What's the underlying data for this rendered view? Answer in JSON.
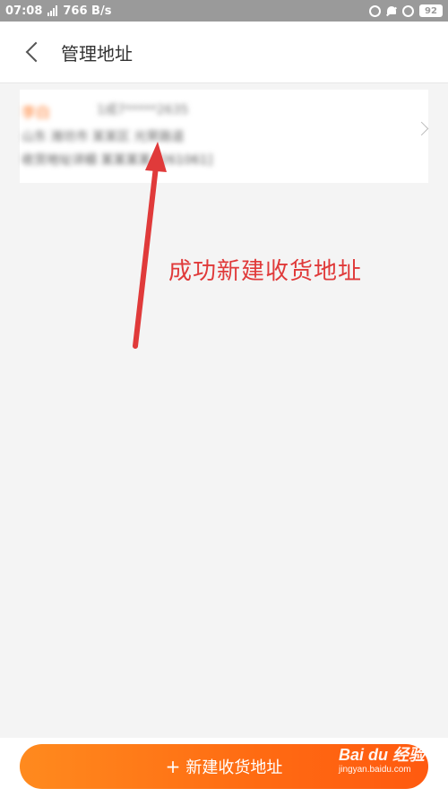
{
  "status_bar": {
    "time": "07:08",
    "network_speed": "766 B/s",
    "battery": "92"
  },
  "header": {
    "title": "管理地址"
  },
  "address_card": {
    "name": "李白",
    "phone": "1成7*****2635",
    "line1": "山东 潍坊市 某某区 光荣路道",
    "line2": "收货地址详细 某某某某 [261061]"
  },
  "annotation": {
    "text": "成功新建收货地址",
    "color": "#e03a3a"
  },
  "bottom": {
    "new_address_label": "新建收货地址",
    "plus_icon": "plus-icon",
    "button_color": "#ff7a1e"
  },
  "watermark": {
    "main": "Bai du 经验",
    "sub": "jingyan.baidu.com"
  }
}
